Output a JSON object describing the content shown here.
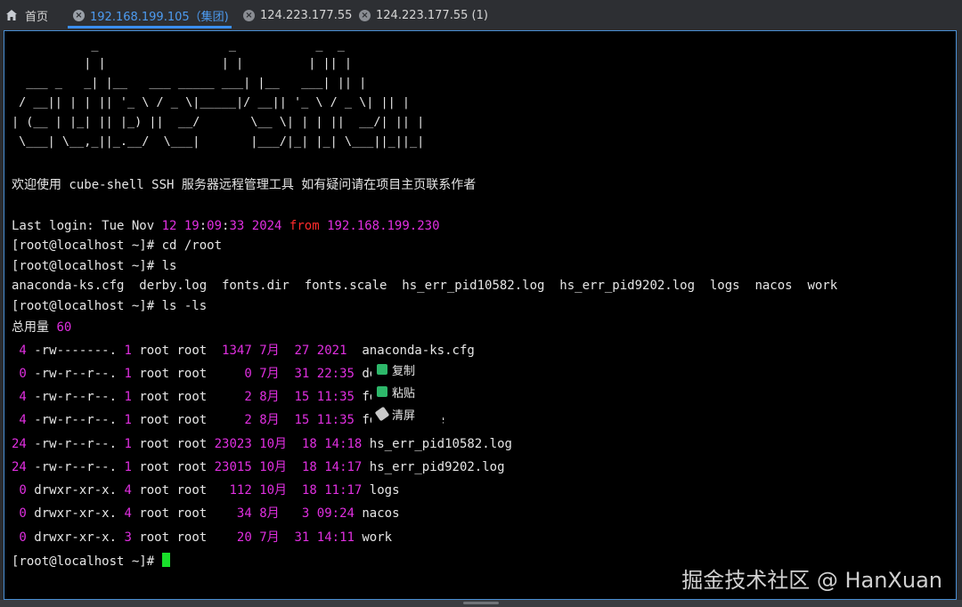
{
  "tabs": [
    {
      "label": "首页"
    },
    {
      "label": "192.168.199.105（集团)"
    },
    {
      "label": "124.223.177.55"
    },
    {
      "label": "124.223.177.55 (1)"
    }
  ],
  "terminal": {
    "ascii_art": [
      "           _                  _           _  _ ",
      "          | |                | |         | || |",
      "  ___ _   _| |__   ___ _____ ___| |__   ___| || |",
      " / __|| | | || '_ \\ / _ \\|_____|/ __|| '_ \\ / _ \\| || |",
      "| (__ | |_| || |_) ||  __/       \\__ \\| | | ||  __/| || |",
      " \\___| \\__,_||_.__/  \\___|       |___/|_| |_| \\___||_||_|"
    ],
    "welcome": "欢迎使用 cube-shell SSH 服务器远程管理工具 如有疑问请在项目主页联系作者",
    "last_login": {
      "prefix": "Last login: Tue Nov ",
      "day": "12",
      "time_h": "19",
      "time_m": "09",
      "time_s": "33",
      "year": "2024",
      "from": "from",
      "ip": "192.168.199.230"
    },
    "prompt": "[root@localhost ~]# ",
    "cmd1": "cd /root",
    "cmd2": "ls",
    "ls_output": "anaconda-ks.cfg  derby.log  fonts.dir  fonts.scale  hs_err_pid10582.log  hs_err_pid9202.log  logs  nacos  work",
    "cmd3": "ls -ls",
    "total_label": "总用量 ",
    "total_value": "60",
    "rows": [
      {
        "blocks": " 4",
        "perm": " -rw-------.",
        "links": "1",
        "owner": " root root  ",
        "size": "1347",
        "month": "7月",
        "day": "27",
        "time": "2021",
        "name": "  anaconda-ks.cfg"
      },
      {
        "blocks": " 0",
        "perm": " -rw-r--r--.",
        "links": "1",
        "owner": " root root     ",
        "size": "0",
        "month": "7月",
        "day": "31",
        "time": "22:35",
        "name": " derby.log"
      },
      {
        "blocks": " 4",
        "perm": " -rw-r--r--.",
        "links": "1",
        "owner": " root root     ",
        "size": "2",
        "month": "8月",
        "day": "15",
        "time": "11:35",
        "name": " fonts.dir"
      },
      {
        "blocks": " 4",
        "perm": " -rw-r--r--.",
        "links": "1",
        "owner": " root root     ",
        "size": "2",
        "month": "8月",
        "day": "15",
        "time": "11:35",
        "name": " fonts.scale"
      },
      {
        "blocks": "24",
        "perm": " -rw-r--r--.",
        "links": "1",
        "owner": " root root ",
        "size": "23023",
        "month": "10月",
        "day": "18",
        "time": "14:18",
        "name": " hs_err_pid10582.log"
      },
      {
        "blocks": "24",
        "perm": " -rw-r--r--.",
        "links": "1",
        "owner": " root root ",
        "size": "23015",
        "month": "10月",
        "day": "18",
        "time": "14:17",
        "name": " hs_err_pid9202.log"
      },
      {
        "blocks": " 0",
        "perm": " drwxr-xr-x.",
        "links": "4",
        "owner": " root root   ",
        "size": "112",
        "month": "10月",
        "day": "18",
        "time": "11:17",
        "name": " logs"
      },
      {
        "blocks": " 0",
        "perm": " drwxr-xr-x.",
        "links": "4",
        "owner": " root root    ",
        "size": "34",
        "month": "8月",
        "day": " 3",
        "time": "09:24",
        "name": " nacos"
      },
      {
        "blocks": " 0",
        "perm": " drwxr-xr-x.",
        "links": "3",
        "owner": " root root    ",
        "size": "20",
        "month": "7月",
        "day": "31",
        "time": "14:11",
        "name": " work"
      }
    ]
  },
  "context_menu": {
    "items": [
      {
        "label": "复制"
      },
      {
        "label": "粘贴"
      },
      {
        "label": "清屏"
      }
    ]
  },
  "watermark": "掘金技术社区 @ HanXuan",
  "colors": {
    "accent": "#4d9bf0",
    "magenta": "#e02fe0",
    "red": "#ff2b2b",
    "cursor": "#19e02b"
  }
}
